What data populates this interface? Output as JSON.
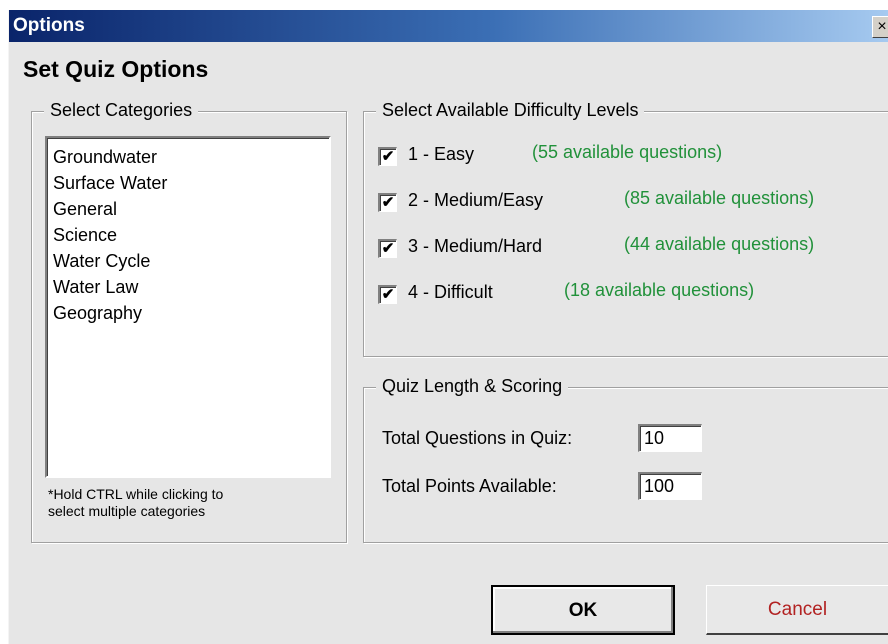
{
  "window": {
    "title": "Options",
    "close_glyph": "×"
  },
  "heading": "Set Quiz Options",
  "categories": {
    "legend": "Select Categories",
    "items": [
      "Groundwater",
      "Surface Water",
      "General",
      "Science",
      "Water Cycle",
      "Water Law",
      "Geography"
    ],
    "hint_line1": "*Hold CTRL while clicking to",
    "hint_line2": "select multiple categories"
  },
  "difficulty": {
    "legend": "Select Available Difficulty Levels",
    "levels": [
      {
        "label": "1 - Easy",
        "count": "(55 available questions)",
        "checked": true
      },
      {
        "label": "2 - Medium/Easy",
        "count": "(85 available questions)",
        "checked": true
      },
      {
        "label": "3 - Medium/Hard",
        "count": "(44 available questions)",
        "checked": true
      },
      {
        "label": "4 - Difficult",
        "count": "(18 available questions)",
        "checked": true
      }
    ],
    "check_glyph": "✔"
  },
  "length": {
    "legend": "Quiz Length & Scoring",
    "questions_label": "Total Questions in Quiz:",
    "questions_value": "10",
    "points_label": "Total Points Available:",
    "points_value": "100"
  },
  "buttons": {
    "ok": "OK",
    "cancel": "Cancel"
  },
  "colors": {
    "count_text": "#21913a",
    "cancel_text": "#b22222",
    "titlebar_start": "#0a246a"
  }
}
